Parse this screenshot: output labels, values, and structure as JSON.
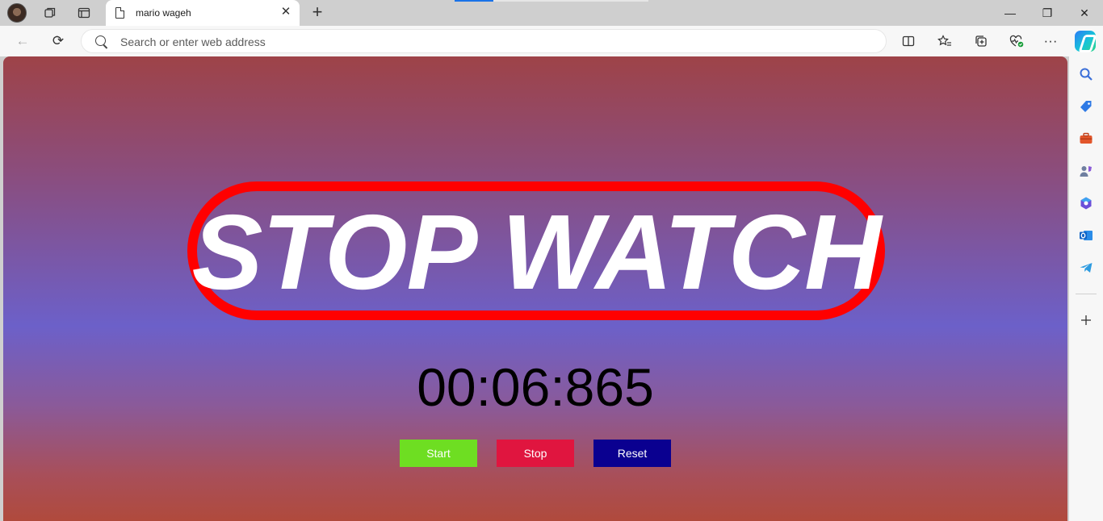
{
  "browser": {
    "tab": {
      "title": "mario wageh"
    },
    "address_bar": {
      "placeholder": "Search or enter web address",
      "value": ""
    },
    "icons": {
      "profile": "avatar",
      "workspaces": "workspaces-icon",
      "tab_actions": "tab-actions-icon",
      "close_tab": "✕",
      "new_tab": "+",
      "back": "←",
      "refresh": "⟳",
      "split_screen": "split-screen-icon",
      "favorites": "star-list-icon",
      "collections": "collections-icon",
      "browser_essentials": "heart-pulse-icon",
      "more": "···",
      "copilot": "copilot-icon"
    },
    "window_controls": {
      "minimize": "—",
      "restore": "❐",
      "close": "✕"
    },
    "sidebar": [
      "search-icon",
      "shopping-tag-icon",
      "tools-icon",
      "games-icon",
      "microsoft365-icon",
      "outlook-icon",
      "telegram-icon",
      "add-icon"
    ]
  },
  "page": {
    "heading": "STOP WATCH",
    "time": "00:06:865",
    "buttons": {
      "start": {
        "label": "Start",
        "color": "#6ede22"
      },
      "stop": {
        "label": "Stop",
        "color": "#e0153f"
      },
      "reset": {
        "label": "Reset",
        "color": "#0a0090"
      }
    },
    "colors": {
      "ring": "#ff0000",
      "heading": "#ffffff",
      "time": "#000000"
    }
  }
}
